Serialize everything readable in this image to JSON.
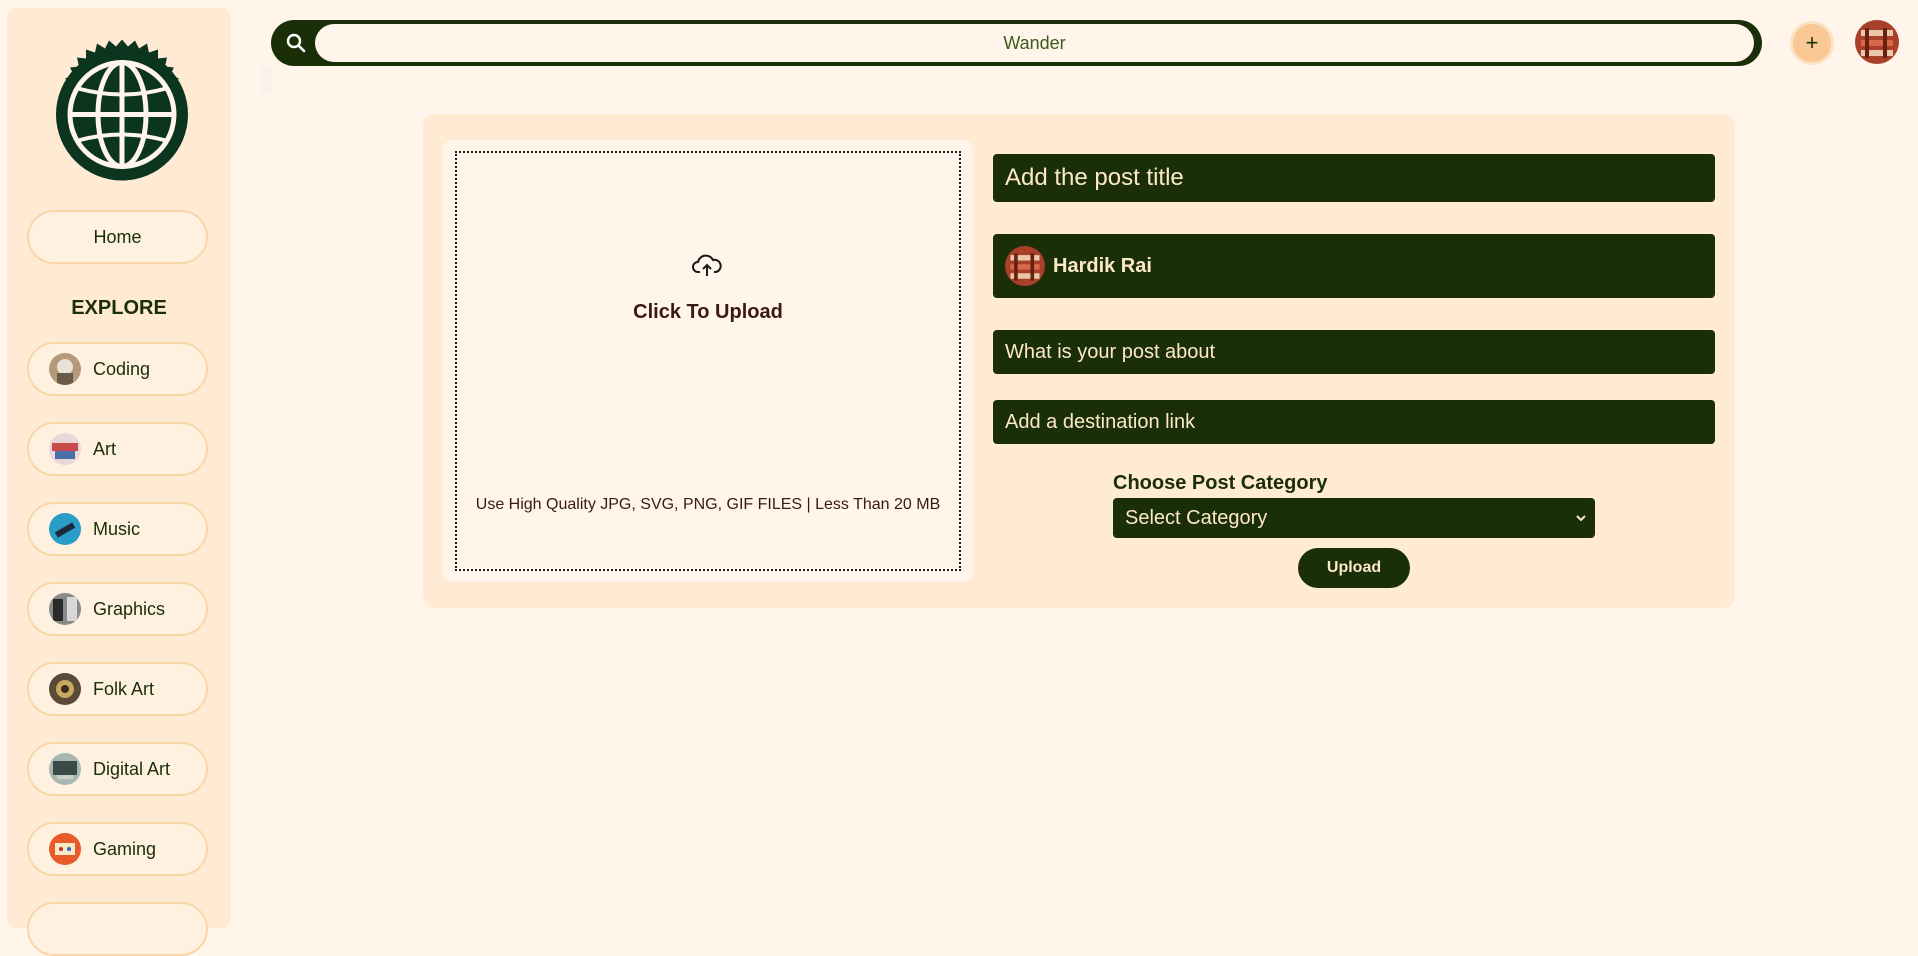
{
  "search": {
    "value": "Wander"
  },
  "header": {
    "add_label": "+"
  },
  "sidebar": {
    "home_label": "Home",
    "explore_heading": "EXPLORE",
    "items": [
      {
        "label": "Coding",
        "icon": "coding-avatar"
      },
      {
        "label": "Art",
        "icon": "art-avatar"
      },
      {
        "label": "Music",
        "icon": "music-avatar"
      },
      {
        "label": "Graphics",
        "icon": "graphics-avatar"
      },
      {
        "label": "Folk Art",
        "icon": "folk-art-avatar"
      },
      {
        "label": "Digital Art",
        "icon": "digital-art-avatar"
      },
      {
        "label": "Gaming",
        "icon": "gaming-avatar"
      }
    ]
  },
  "upload": {
    "title": "Click To Upload",
    "hint": "Use High Quality JPG, SVG, PNG, GIF FILES | Less Than 20 MB"
  },
  "form": {
    "title_placeholder": "Add the post title",
    "author_name": "Hardik Rai",
    "about_placeholder": "What is your post about",
    "link_placeholder": "Add a destination link",
    "category_label": "Choose Post Category",
    "category_selected": "Select Category",
    "submit_label": "Upload"
  },
  "colors": {
    "primary": "#1a2e08",
    "background": "#fff5eb",
    "panel": "#ffebd3",
    "accent": "#f9c895"
  }
}
